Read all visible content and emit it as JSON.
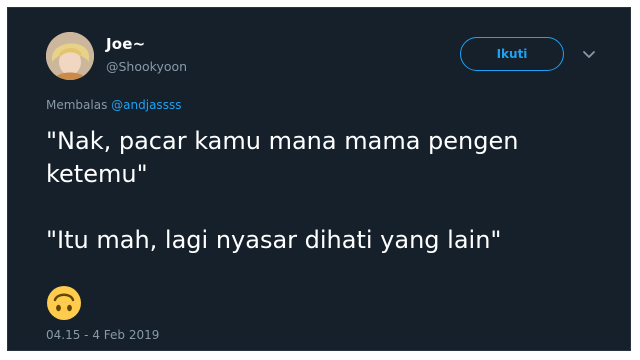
{
  "user": {
    "name": "Joe~",
    "handle": "@Shookyoon"
  },
  "follow_button": {
    "label": "Ikuti"
  },
  "menu_icon": "chevron-down-icon",
  "reply": {
    "prefix": "Membalas",
    "mention": "@andjassss"
  },
  "tweet": {
    "line1": "\"Nak, pacar kamu mana mama pengen",
    "line2": "ketemu\"",
    "line3": "\"Itu mah, lagi nyasar dihati yang lain\"",
    "emoji": "upside-down-face-emoji"
  },
  "timestamp": "04.15 - 4 Feb 2019",
  "colors": {
    "background": "#15202b",
    "accent": "#1da1f2",
    "secondary_text": "#8899a6",
    "primary_text": "#ffffff"
  }
}
